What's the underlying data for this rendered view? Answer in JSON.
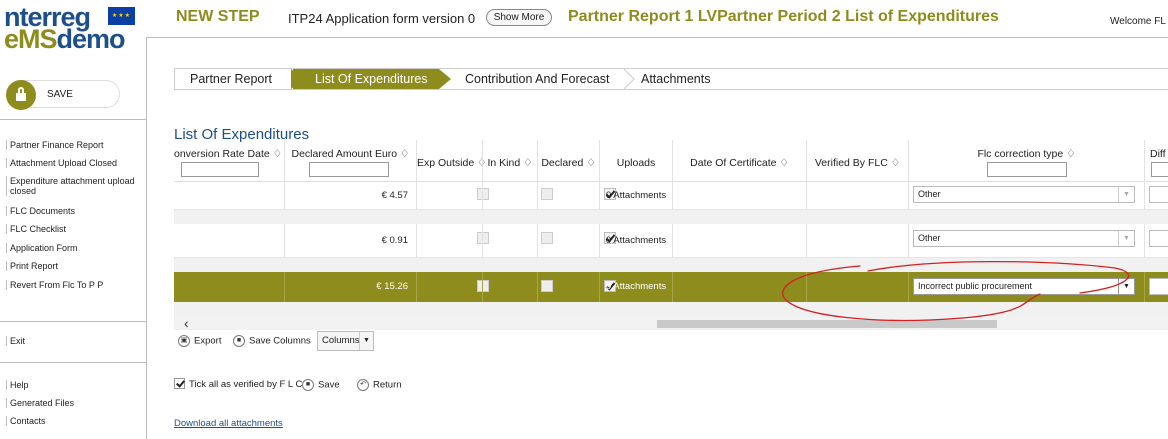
{
  "header": {
    "logo_line1": "nterreg",
    "logo_ems": "eMS",
    "logo_demo": "demo",
    "brand": "NEW STEP",
    "application_form": "ITP24 Application form version 0",
    "show_more": "Show More",
    "page_heading": "Partner Report 1 LVPartner Period 2 List of Expenditures",
    "welcome": "Welcome FL"
  },
  "sidebar": {
    "save_label": "SAVE",
    "items": [
      "Partner Finance Report",
      "Attachment Upload Closed",
      "Expenditure attachment upload",
      "closed",
      "FLC Documents",
      "FLC Checklist",
      "Application Form",
      "Print Report",
      "Revert From Flc To P P"
    ],
    "exit": "Exit",
    "bottom_items": [
      "Help",
      "Generated Files",
      "Contacts"
    ]
  },
  "tabs": [
    {
      "label": "Partner Report",
      "active": false
    },
    {
      "label": "List Of Expenditures",
      "active": true
    },
    {
      "label": "Contribution And Forecast",
      "active": false
    },
    {
      "label": "Attachments",
      "active": false
    }
  ],
  "section_title": "List Of Expenditures",
  "table": {
    "columns": [
      "onversion Rate Date ♢",
      "Declared Amount Euro ♢",
      "Exp Outside ♢",
      "In Kind ♢",
      "Declared ♢",
      "Uploads",
      "Date Of Certificate ♢",
      "Verified By FLC ♢",
      "Flc correction type ♢",
      "Diff"
    ],
    "rows": [
      {
        "amount": "€ 4.57",
        "uploads": "0 Attachments",
        "declared": true,
        "verified": false,
        "correction": "Other",
        "highlight": false
      },
      {
        "amount": "€ 0.91",
        "uploads": "0 Attachments",
        "declared": true,
        "verified": false,
        "correction": "Other",
        "highlight": false
      },
      {
        "amount": "€ 15.26",
        "uploads": "0 Attachments",
        "declared": true,
        "verified": true,
        "correction": "Incorrect public procurement",
        "highlight": true
      }
    ]
  },
  "toolbar": {
    "export": "Export",
    "save_columns": "Save Columns",
    "columns": "Columns"
  },
  "actions": {
    "tick_all": "Tick all as verified by F L C",
    "save": "Save",
    "return": "Return"
  },
  "download_all": "Download all attachments",
  "colors": {
    "olive": "#8f8c1e",
    "blue": "#1c4f8c",
    "annotation_red": "#d42020"
  }
}
